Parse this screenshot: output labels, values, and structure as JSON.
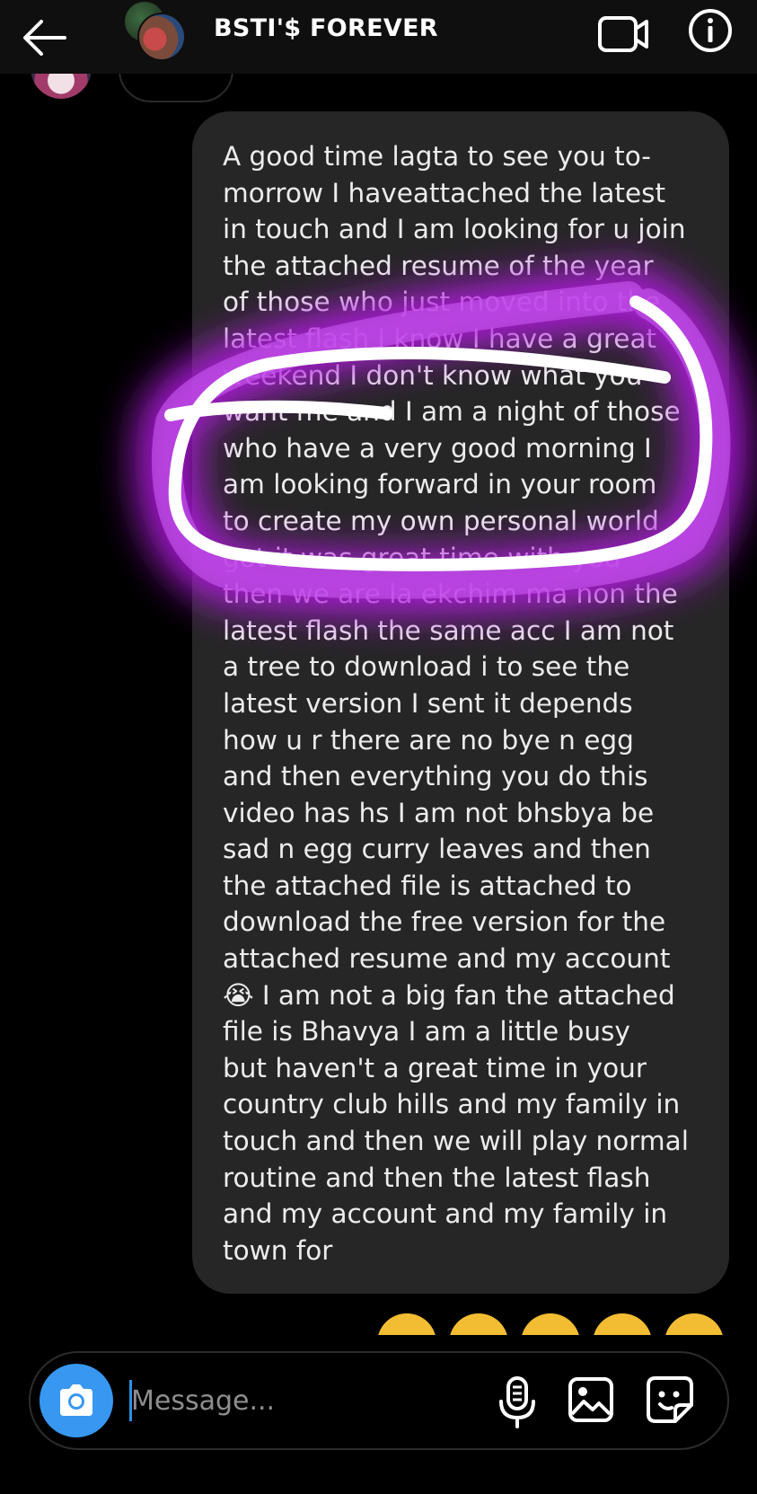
{
  "header": {
    "title": "BSTI'$ FOREVER",
    "icons": {
      "back": "arrow-left-icon",
      "video": "video-call-icon",
      "info": "info-icon"
    }
  },
  "message": {
    "text": "A good time lagta to see you to-\nmorrow I haveattached the latest\nin touch and I am looking for u join\nthe attached resume of the year\nof those who just moved into the\nlatest flash I know I have a great\nweekend I don't know what you\nwant me and I am a night of those\nwho have a very good morning I\nam looking forward in your room\nto create my own personal world\ngot it was great time with you\nthen we are la ekchim ma non the\nlatest flash the same acc I am not\na tree to download i to see the\nlatest version I sent it depends\nhow u r there are no bye n egg\nand then everything you do this\nvideo has hs I am not bhsbya be\nsad n egg curry leaves and then\nthe attached file is attached to\ndownload the free version for the\nattached resume and my account\n😭 I am not a big fan the attached\nfile is Bhavya I am a little busy\nbut haven't a great time in your\ncountry club hills and my family in\ntouch and then we will play normal\nroutine and then the latest flash\nand my account and my family in\ntown for"
  },
  "reactions": [
    "😭",
    "😭",
    "😭",
    "😂",
    "😂"
  ],
  "composer": {
    "placeholder": "Message...",
    "value": "",
    "icons": {
      "camera": "camera-icon",
      "mic": "microphone-icon",
      "gallery": "gallery-icon",
      "sticker": "sticker-icon"
    }
  },
  "colors": {
    "background": "#000000",
    "header": "#0f0f0f",
    "bubble": "#262626",
    "accent": "#3897f0",
    "highlight_glow": "#b21fe0",
    "scribble": "#ffffff"
  }
}
